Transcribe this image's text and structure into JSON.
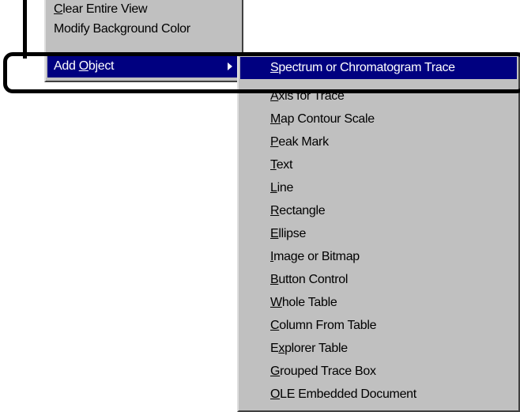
{
  "parent_menu": {
    "items": [
      {
        "mnemonic": "C",
        "rest": "lear Entire View"
      },
      {
        "mnemonic": "",
        "rest": "Modify Background Color"
      },
      {
        "pre": "Add ",
        "mnemonic": "O",
        "rest": "bject",
        "selected": true,
        "has_submenu": true
      }
    ]
  },
  "submenu": {
    "items": [
      {
        "pre": "",
        "mnemonic": "S",
        "rest": "pectrum or Chromatogram Trace",
        "selected": true
      },
      {
        "pre": "",
        "mnemonic": "A",
        "rest": "xis for Trace"
      },
      {
        "pre": "",
        "mnemonic": "M",
        "rest": "ap Contour Scale"
      },
      {
        "pre": "",
        "mnemonic": "P",
        "rest": "eak Mark"
      },
      {
        "pre": "",
        "mnemonic": "T",
        "rest": "ext"
      },
      {
        "pre": "",
        "mnemonic": "L",
        "rest": "ine"
      },
      {
        "pre": "",
        "mnemonic": "R",
        "rest": "ectangle"
      },
      {
        "pre": "",
        "mnemonic": "E",
        "rest": "llipse"
      },
      {
        "pre": "",
        "mnemonic": "I",
        "rest": "mage or Bitmap"
      },
      {
        "pre": "",
        "mnemonic": "B",
        "rest": "utton Control"
      },
      {
        "pre": "",
        "mnemonic": "W",
        "rest": "hole Table"
      },
      {
        "pre": "",
        "mnemonic": "C",
        "rest": "olumn From Table"
      },
      {
        "pre": "E",
        "mnemonic": "x",
        "rest": "plorer Table"
      },
      {
        "pre": "",
        "mnemonic": "G",
        "rest": "rouped Trace Box"
      },
      {
        "pre": "",
        "mnemonic": "O",
        "rest": "LE Embedded Document"
      }
    ]
  },
  "icons": {
    "submenu_arrow": "right-triangle-arrow-icon"
  },
  "colors": {
    "menu_bg": "#c0c0c0",
    "highlight_bg": "#000080",
    "highlight_text": "#ffffff",
    "callout": "#000000"
  }
}
